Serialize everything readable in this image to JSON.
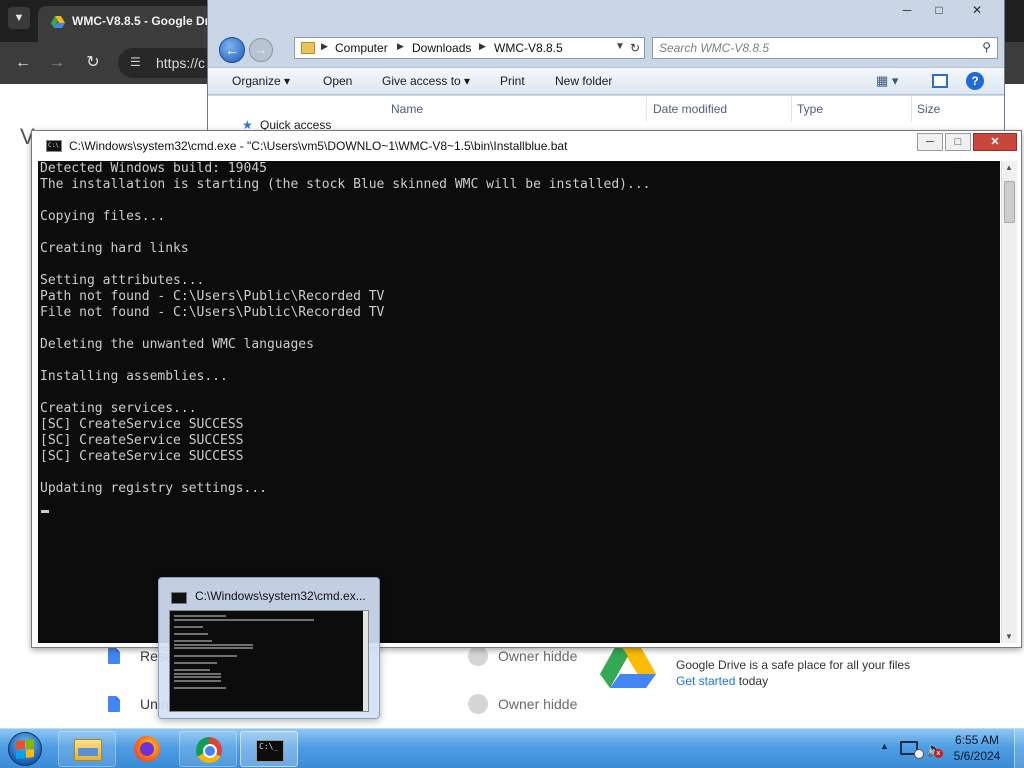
{
  "chrome": {
    "tab_title": "WMC-V8.8.5 - Google Dr",
    "url": "https://c",
    "page_partial_heading": "V",
    "rows": [
      {
        "name": "Rese",
        "owner": "Owner hidde"
      },
      {
        "name": "Unin",
        "owner": "Owner hidde"
      }
    ],
    "drive_promo": {
      "line1": "Google Drive is a safe place for all your files",
      "link": "Get started",
      "link_suffix": " today"
    }
  },
  "explorer": {
    "breadcrumb": [
      "Computer",
      "Downloads",
      "WMC-V8.8.5"
    ],
    "search_placeholder": "Search WMC-V8.8.5",
    "commands": [
      "Organize",
      "Open",
      "Give access to",
      "Print",
      "New folder"
    ],
    "columns": [
      "Name",
      "Date modified",
      "Type",
      "Size"
    ],
    "nav_item": "Quick access"
  },
  "cmd": {
    "title": "C:\\Windows\\system32\\cmd.exe - \"C:\\Users\\vm5\\DOWNLO~1\\WMC-V8~1.5\\bin\\Installblue.bat",
    "lines": [
      "Detected Windows build: 19045",
      "The installation is starting (the stock Blue skinned WMC will be installed)...",
      "",
      "Copying files...",
      "",
      "Creating hard links",
      "",
      "Setting attributes...",
      "Path not found - C:\\Users\\Public\\Recorded TV",
      "File not found - C:\\Users\\Public\\Recorded TV",
      "",
      "Deleting the unwanted WMC languages",
      "",
      "Installing assemblies...",
      "",
      "Creating services...",
      "[SC] CreateService SUCCESS",
      "[SC] CreateService SUCCESS",
      "[SC] CreateService SUCCESS",
      "",
      "Updating registry settings..."
    ]
  },
  "preview": {
    "title": "C:\\Windows\\system32\\cmd.ex..."
  },
  "taskbar": {
    "time": "6:55 AM",
    "date": "5/6/2024"
  },
  "icons": {
    "start": "windows-start-orb",
    "explorer": "folder-icon",
    "firefox": "firefox-icon",
    "chrome": "chrome-icon",
    "cmd": "cmd-icon"
  },
  "colors": {
    "console_bg": "#0c0c0c",
    "console_text": "#cccccc",
    "taskbar": "#4f9ee3",
    "close_button": "#c9463d",
    "link": "#1a73e8"
  }
}
